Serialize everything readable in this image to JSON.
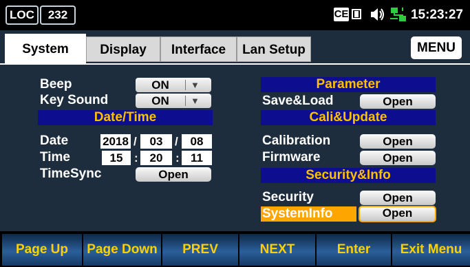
{
  "status_bar": {
    "mode": "LOC",
    "address": "232",
    "indicators": [
      "CE",
      "▣",
      "🔈",
      "network-icon"
    ],
    "time": "15:23:27"
  },
  "tabs": [
    {
      "label": "System",
      "active": true
    },
    {
      "label": "Display",
      "active": false
    },
    {
      "label": "Interface",
      "active": false
    },
    {
      "label": "Lan Setup",
      "active": false
    }
  ],
  "menu_label": "MENU",
  "left": {
    "beep": {
      "label": "Beep",
      "value": "ON"
    },
    "key_sound": {
      "label": "Key Sound",
      "value": "ON"
    },
    "datetime_header": "Date/Time",
    "date": {
      "label": "Date",
      "year": "2018",
      "month": "03",
      "day": "08",
      "sep": "/"
    },
    "time": {
      "label": "Time",
      "hour": "15",
      "minute": "20",
      "second": "11",
      "sep": ":"
    },
    "timesync": {
      "label": "TimeSync",
      "button": "Open"
    }
  },
  "right": {
    "parameter_header": "Parameter",
    "save_load": {
      "label": "Save&Load",
      "button": "Open"
    },
    "cali_header": "Cali&Update",
    "calibration": {
      "label": "Calibration",
      "button": "Open"
    },
    "firmware": {
      "label": "Firmware",
      "button": "Open"
    },
    "security_header": "Security&Info",
    "security": {
      "label": "Security",
      "button": "Open"
    },
    "systeminfo": {
      "label": "SystemInfo",
      "button": "Open",
      "selected": true
    }
  },
  "softkeys": [
    "Page Up",
    "Page Down",
    "PREV",
    "NEXT",
    "Enter",
    "Exit Menu"
  ],
  "colors": {
    "accent": "#ffa500",
    "header_bg": "#0d0d8f",
    "header_text": "#ffc000",
    "softkey_text": "#ffd000",
    "panel_bg": "#1e2d3d"
  }
}
